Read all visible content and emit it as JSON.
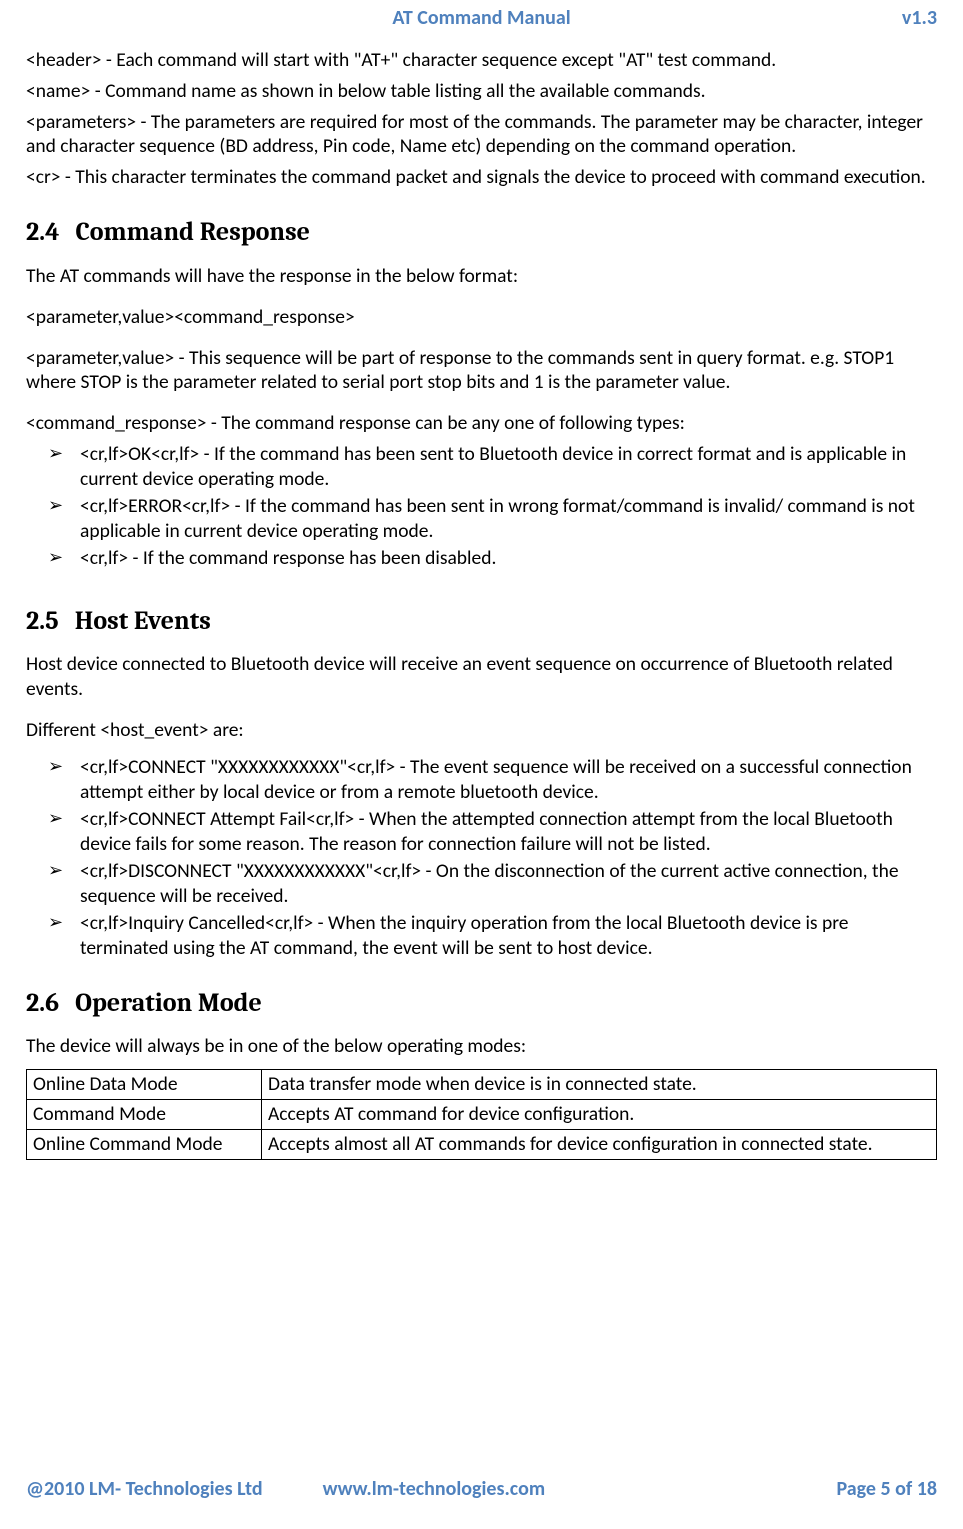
{
  "header": {
    "title": "AT Command Manual",
    "version": "v1.3"
  },
  "intro": {
    "l1": "<header> - Each command will start with \"AT+\" character sequence except \"AT\" test command.",
    "l2": "<name> - Command name as shown in below table listing all the available commands.",
    "l3": "<parameters> - The parameters are required for most of the commands. The parameter may be character, integer and character sequence (BD address, Pin code, Name etc) depending on the command operation.",
    "l4": "<cr> - This character terminates the command packet and signals the device to proceed with command execution."
  },
  "s24": {
    "num": "2.4",
    "title": "Command Response",
    "p1": "The AT commands will have the response in the below format:",
    "p2": "<parameter,value><command_response>",
    "p3": "<parameter,value> - This sequence will be part of response to the commands sent in query format. e.g. STOP1 where STOP is the parameter related to serial port stop bits and 1 is the parameter value.",
    "p4": "<command_response> - The command response can be any one of following types:",
    "items": [
      "<cr,lf>OK<cr,lf> - If the command has been sent to Bluetooth device in correct format and is applicable in current device operating mode.",
      "<cr,lf>ERROR<cr,lf> - If the command has been sent in wrong format/command is invalid/ command   is not applicable in current device operating mode.",
      "<cr,lf>  - If the command response has been disabled."
    ]
  },
  "s25": {
    "num": "2.5",
    "title": "Host Events",
    "p1": "Host device connected to Bluetooth device will receive an event sequence on occurrence of Bluetooth related events.",
    "p2": "Different <host_event> are:",
    "items": [
      "<cr,lf>CONNECT \"XXXXXXXXXXXX\"<cr,lf> - The event sequence will be received on a successful connection attempt either by local device or from a remote bluetooth device.",
      "<cr,lf>CONNECT Attempt Fail<cr,lf>  - When the attempted connection attempt from the local Bluetooth device fails for some reason.  The reason for connection failure will not be listed.",
      "<cr,lf>DISCONNECT \"XXXXXXXXXXXX\"<cr,lf> - On the disconnection of the current active connection, the sequence will be received.",
      "<cr,lf>Inquiry Cancelled<cr,lf> - When the inquiry operation from the local Bluetooth device is pre terminated using the AT command, the event will be sent to host device."
    ]
  },
  "s26": {
    "num": "2.6",
    "title": "Operation Mode",
    "p1": "The device will always be in one of the below operating modes:",
    "rows": [
      {
        "mode": "Online Data Mode",
        "desc": "Data transfer mode when device is in connected state."
      },
      {
        "mode": "Command Mode",
        "desc": "Accepts AT command for device configuration."
      },
      {
        "mode": "Online Command Mode",
        "desc": "Accepts almost all AT commands for device configuration in connected state."
      }
    ]
  },
  "footer": {
    "left": "@2010 LM- Technologies Ltd",
    "center": "www.lm-technologies.com",
    "right": "Page 5 of 18"
  }
}
